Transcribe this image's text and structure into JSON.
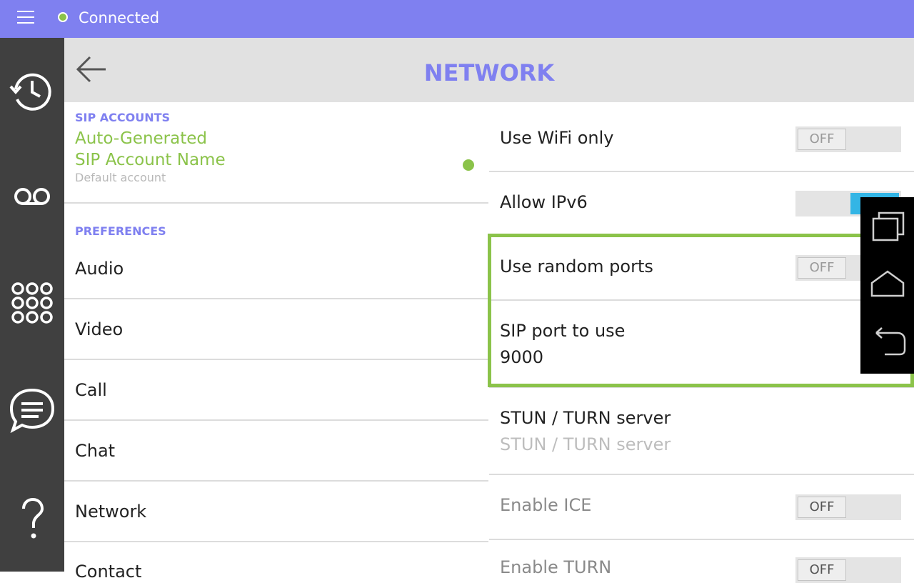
{
  "status_bar": {
    "connection_status": "Connected",
    "status_color": "#8bc34a",
    "accent_color": "#7f80f0"
  },
  "sidebar": {
    "items": [
      {
        "icon": "history-icon"
      },
      {
        "icon": "voicemail-icon"
      },
      {
        "icon": "dialpad-icon"
      },
      {
        "icon": "chat-bubble-icon"
      },
      {
        "icon": "help-icon"
      }
    ]
  },
  "header": {
    "title": "NETWORK",
    "back_icon": "back-arrow-icon"
  },
  "left_panel": {
    "sip_accounts_heading": "SIP ACCOUNTS",
    "account_name_line1": "Auto-Generated",
    "account_name_line2": "SIP Account Name",
    "account_sub": "Default account",
    "preferences_heading": "PREFERENCES",
    "items": [
      "Audio",
      "Video",
      "Call",
      "Chat",
      "Network",
      "Contact"
    ]
  },
  "settings": {
    "use_wifi_only": {
      "label": "Use WiFi only",
      "toggle": "OFF",
      "on": false
    },
    "allow_ipv6": {
      "label": "Allow IPv6",
      "on": true
    },
    "use_random_ports": {
      "label": "Use random ports",
      "toggle": "OFF",
      "on": false
    },
    "sip_port": {
      "label": "SIP port to use",
      "value": "9000"
    },
    "stun_turn": {
      "label": "STUN / TURN server",
      "placeholder": "STUN / TURN server"
    },
    "enable_ice": {
      "label": "Enable ICE",
      "toggle": "OFF",
      "on": false
    },
    "enable_turn": {
      "label": "Enable TURN",
      "toggle": "OFF",
      "on": false
    }
  },
  "nav_overlay": {
    "icons": [
      "recent-apps-icon",
      "home-icon",
      "back-icon"
    ]
  }
}
